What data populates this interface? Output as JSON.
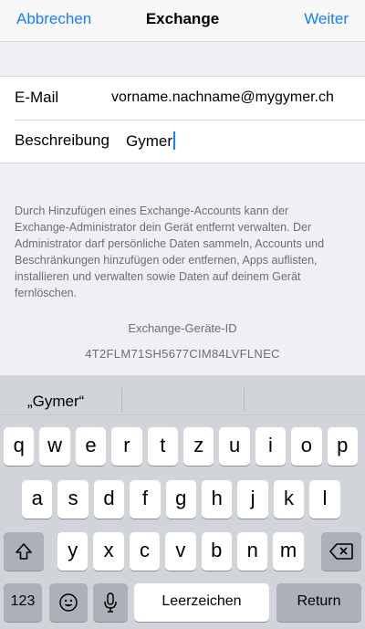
{
  "nav": {
    "cancel": "Abbrechen",
    "title": "Exchange",
    "next": "Weiter"
  },
  "form": {
    "email_label": "E-Mail",
    "email_value": "vorname.nachname@mygymer.ch",
    "desc_label": "Beschreibung",
    "desc_value": "Gymer"
  },
  "info_text": "Durch Hinzufügen eines Exchange-Accounts kann der Exchange-Administrator dein Gerät entfernt verwalten. Der Administrator darf persönliche Daten sammeln, Accounts und Beschränkungen hinzufügen oder entfernen, Apps auflisten, installieren und verwalten sowie Daten auf deinem Gerät fernlöschen.",
  "device": {
    "label": "Exchange-Geräte-ID",
    "id": "4T2FLM71SH5677CIM84LVFLNEC"
  },
  "keyboard": {
    "suggestions": [
      "„Gymer“",
      "",
      ""
    ],
    "row1": [
      "q",
      "w",
      "e",
      "r",
      "t",
      "z",
      "u",
      "i",
      "o",
      "p"
    ],
    "row2": [
      "a",
      "s",
      "d",
      "f",
      "g",
      "h",
      "j",
      "k",
      "l"
    ],
    "row3": [
      "y",
      "x",
      "c",
      "v",
      "b",
      "n",
      "m"
    ],
    "numbers_key": "123",
    "space_key": "Leerzeichen",
    "return_key": "Return",
    "shift_icon": "shift-icon",
    "delete_icon": "delete-icon",
    "emoji_icon": "emoji-icon",
    "mic_icon": "microphone-icon"
  },
  "colors": {
    "accent": "#1a7ef5",
    "background": "#efeff4",
    "keyboard": "#d1d4d9"
  }
}
